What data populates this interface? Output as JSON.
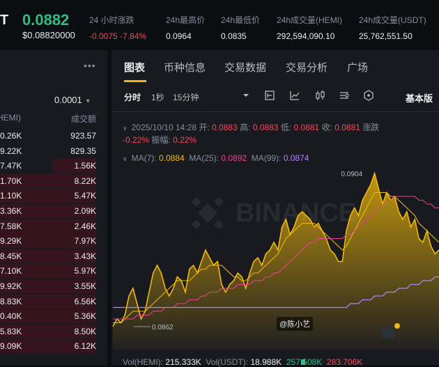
{
  "ticker": {
    "symbol_fragment": "T",
    "price": "0.0882",
    "price_usd": "$0.08820000",
    "stats": [
      {
        "label": "24 小时涨跌",
        "value": "-0.0075 -7.84%",
        "color": "red"
      },
      {
        "label": "24h最高价",
        "value": "0.0964",
        "color": "white"
      },
      {
        "label": "24h最低价",
        "value": "0.0835",
        "color": "white"
      },
      {
        "label": "24h成交量(HEMI)",
        "value": "292,594,090.10",
        "color": "white"
      },
      {
        "label": "24h成交量(USDT)",
        "value": "25,762,551.50",
        "color": "white"
      }
    ]
  },
  "orderbook": {
    "menu": "•••",
    "precision": "0.0001",
    "col_amount": "HEMI)",
    "col_total": "成交额",
    "rows": [
      {
        "amount": "0.26K",
        "total": "923.57",
        "depth": 0.0
      },
      {
        "amount": "9.22K",
        "total": "829.35",
        "depth": 0.0
      },
      {
        "amount": "7.47K",
        "total": "1.56K",
        "depth": 0.41
      },
      {
        "amount": "1.70K",
        "total": "8.22K",
        "depth": 1.0
      },
      {
        "amount": "1.10K",
        "total": "5.47K",
        "depth": 1.0
      },
      {
        "amount": "3.36K",
        "total": "2.09K",
        "depth": 1.0
      },
      {
        "amount": "7.58K",
        "total": "2.46K",
        "depth": 1.0
      },
      {
        "amount": "9.29K",
        "total": "7.97K",
        "depth": 1.0
      },
      {
        "amount": "8.45K",
        "total": "3.43K",
        "depth": 1.0
      },
      {
        "amount": "7.10K",
        "total": "5.97K",
        "depth": 1.0
      },
      {
        "amount": "9.92K",
        "total": "3.55K",
        "depth": 1.0
      },
      {
        "amount": "8.83K",
        "total": "6.56K",
        "depth": 1.0
      },
      {
        "amount": "0.40K",
        "total": "5.36K",
        "depth": 1.0
      },
      {
        "amount": "5.83K",
        "total": "8.50K",
        "depth": 1.0
      },
      {
        "amount": "9.09K",
        "total": "6.12K",
        "depth": 1.0
      }
    ]
  },
  "chart_panel": {
    "tabs": [
      "图表",
      "币种信息",
      "交易数据",
      "交易分析",
      "广场"
    ],
    "toolbar": {
      "interval_time": "分时",
      "interval_1s": "1秒",
      "interval_15m": "15分钟",
      "basic": "基本版",
      "icons": [
        "dropdown-icon",
        "indicator-icon",
        "line-chart-icon",
        "candlestick-icon",
        "settings-list-icon",
        "hexagon-icon"
      ]
    },
    "ohlc": {
      "date": "2025/10/10 14:28",
      "open_label": "开:",
      "open": "0.0883",
      "high_label": "高:",
      "high": "0.0883",
      "low_label": "低:",
      "low": "0.0881",
      "close_label": "收:",
      "close": "0.0881",
      "change_label": "涨跌",
      "change": "-0.22%",
      "amp_label": "振幅:",
      "amp": "0.22%"
    },
    "ma": {
      "ma7_label": "MA(7):",
      "ma7": "0.0884",
      "ma25_label": "MA(25):",
      "ma25": "0.0892",
      "ma99_label": "MA(99):",
      "ma99": "0.0874"
    },
    "volume": {
      "vol_hemi_label": "Vol(HEMI):",
      "vol_hemi": "215.333K",
      "vol_usdt_label": "Vol(USDT):",
      "vol_usdt": "18.988K",
      "vol_a": "257.508K",
      "vol_b": "283.706K"
    },
    "watermark": "BINANCE",
    "user_tag": "@陈小艺",
    "colors": {
      "up": "#2ebd85",
      "down": "#f6465d",
      "accent": "#f0b90b",
      "ma25": "#e84393",
      "ma99": "#b084f5"
    }
  },
  "chart_data": {
    "type": "area",
    "annotations": {
      "max_label": "0.0904",
      "min_label": "0.0862"
    },
    "series": [
      {
        "values": [
          0.0864,
          0.0866,
          0.0865,
          0.0867,
          0.0872,
          0.0874,
          0.087,
          0.0866,
          0.0868,
          0.0873,
          0.0878,
          0.088,
          0.0878,
          0.0874,
          0.0872,
          0.0874,
          0.0877,
          0.0876,
          0.0873,
          0.0879,
          0.088,
          0.0878,
          0.0881,
          0.0884,
          0.0882,
          0.088,
          0.0881,
          0.0875,
          0.0873,
          0.0875,
          0.0876,
          0.0878,
          0.0877,
          0.0874,
          0.0878,
          0.0881,
          0.0882,
          0.088,
          0.0883,
          0.0884,
          0.0886,
          0.0884,
          0.089,
          0.0892,
          0.0888,
          0.089,
          0.0893,
          0.0894,
          0.0893,
          0.0892,
          0.089,
          0.0891,
          0.0889,
          0.0887,
          0.0884,
          0.0883,
          0.0881,
          0.0881,
          0.0889,
          0.0893,
          0.0895,
          0.0893,
          0.0897,
          0.0899,
          0.0901,
          0.0904,
          0.09,
          0.0896,
          0.0899,
          0.0897,
          0.0898,
          0.0894,
          0.0892,
          0.0894,
          0.089,
          0.0892,
          0.0887,
          0.0886,
          0.0889,
          0.0885,
          0.0883,
          0.0884
        ]
      },
      {
        "values": [
          0.0865,
          0.0865,
          0.0865,
          0.0866,
          0.0867,
          0.0868,
          0.0868,
          0.0868,
          0.0868,
          0.0869,
          0.087,
          0.0871,
          0.0872,
          0.0873,
          0.0874,
          0.0875,
          0.0876,
          0.0876,
          0.0876,
          0.0876,
          0.0877,
          0.0878,
          0.0879,
          0.0879,
          0.088,
          0.088,
          0.088,
          0.088,
          0.0879,
          0.0878,
          0.0877,
          0.0877,
          0.0876,
          0.0876,
          0.0877,
          0.0878,
          0.0878,
          0.0879,
          0.088,
          0.0881,
          0.0882,
          0.0883,
          0.0885,
          0.0887,
          0.0888,
          0.0889,
          0.089,
          0.0891,
          0.0891,
          0.0891,
          0.0891,
          0.089,
          0.0889,
          0.0888,
          0.0887,
          0.0886,
          0.0885,
          0.0884,
          0.0885,
          0.0887,
          0.0889,
          0.0891,
          0.0893,
          0.0895,
          0.0897,
          0.0899,
          0.0899,
          0.0899,
          0.0899,
          0.0898,
          0.0898,
          0.0897,
          0.0896,
          0.0895,
          0.0894,
          0.0893,
          0.0891,
          0.089,
          0.0889,
          0.0888,
          0.0887,
          0.0886
        ]
      },
      {
        "values": [
          0.0866,
          0.0866,
          0.0866,
          0.0866,
          0.0866,
          0.0866,
          0.0867,
          0.0867,
          0.0867,
          0.0867,
          0.0868,
          0.0868,
          0.0868,
          0.0869,
          0.0869,
          0.0869,
          0.087,
          0.087,
          0.087,
          0.0871,
          0.0871,
          0.0871,
          0.0872,
          0.0872,
          0.0873,
          0.0873,
          0.0873,
          0.0874,
          0.0874,
          0.0874,
          0.0874,
          0.0875,
          0.0875,
          0.0875,
          0.0875,
          0.0876,
          0.0876,
          0.0876,
          0.0877,
          0.0877,
          0.0878,
          0.0878,
          0.0879,
          0.088,
          0.0881,
          0.0882,
          0.0883,
          0.0884,
          0.0885,
          0.0886,
          0.0886,
          0.0887,
          0.0887,
          0.0887,
          0.0887,
          0.0887,
          0.0887,
          0.0887,
          0.0888,
          0.0888,
          0.0889,
          0.089,
          0.0891,
          0.0892,
          0.0893,
          0.0894,
          0.0895,
          0.0896,
          0.0897,
          0.0897,
          0.0898,
          0.0898,
          0.0898,
          0.0898,
          0.0898,
          0.0898,
          0.0897,
          0.0897,
          0.0896,
          0.0896,
          0.0895,
          0.0895
        ]
      },
      {
        "values": [
          0.0869,
          0.0869,
          0.0869,
          0.0869,
          0.0869,
          0.0869,
          0.0869,
          0.0869,
          0.0869,
          0.0869,
          0.0869,
          0.0869,
          0.0869,
          0.0869,
          0.0869,
          0.0869,
          0.0869,
          0.0869,
          0.0869,
          0.0869,
          0.0869,
          0.0869,
          0.0869,
          0.0869,
          0.0869,
          0.0869,
          0.0869,
          0.0869,
          0.0869,
          0.0869,
          0.0869,
          0.0869,
          0.0869,
          0.0869,
          0.0869,
          0.0869,
          0.0869,
          0.0869,
          0.0869,
          0.0869,
          0.0869,
          0.0869,
          0.0869,
          0.0869,
          0.0869,
          0.0869,
          0.0869,
          0.0869,
          0.0869,
          0.0869,
          0.0869,
          0.0869,
          0.0869,
          0.0869,
          0.0869,
          0.0869,
          0.0869,
          0.0869,
          0.0869,
          0.087,
          0.087,
          0.087,
          0.0871,
          0.0871,
          0.0871,
          0.0872,
          0.0872,
          0.0872,
          0.0873,
          0.0873,
          0.0873,
          0.0874,
          0.0874,
          0.0874,
          0.0875,
          0.0875,
          0.0875,
          0.0876,
          0.0876,
          0.0876,
          0.0877,
          0.0877
        ]
      }
    ]
  }
}
